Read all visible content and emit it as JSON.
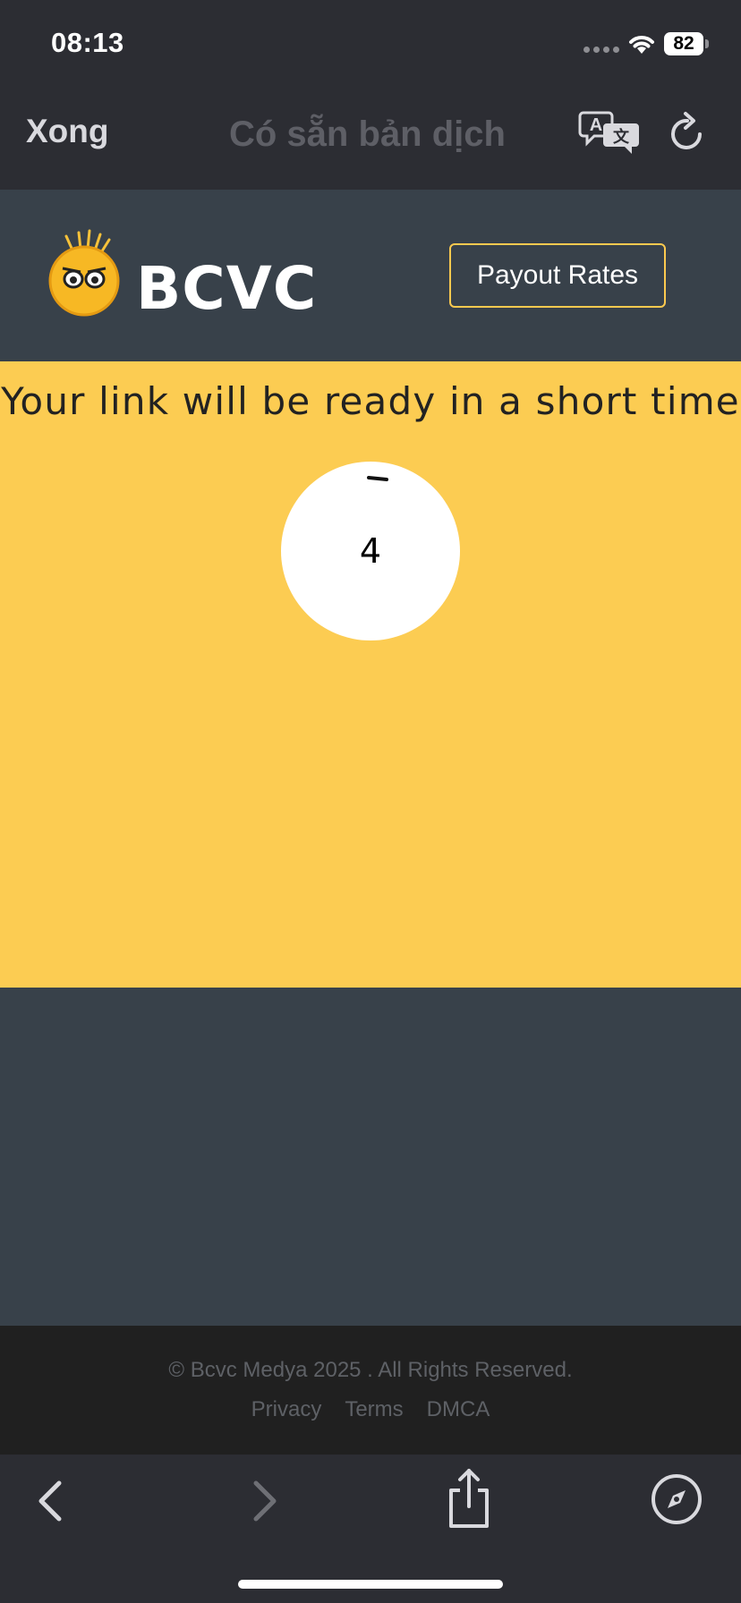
{
  "status_bar": {
    "time": "08:13",
    "battery": "82"
  },
  "browser_nav": {
    "done_label": "Xong",
    "title": "Có sẵn bản dịch",
    "translate_icon": "translate-icon",
    "reload_icon": "reload-icon"
  },
  "site_header": {
    "logo_text": "BCVC",
    "payout_label": "Payout Rates"
  },
  "main": {
    "headline": "Your link will be ready in a short time",
    "countdown": "4"
  },
  "footer": {
    "copyright": "© Bcvc Medya 2025 . All Rights Reserved.",
    "links": [
      "Privacy",
      "Terms",
      "DMCA"
    ]
  },
  "toolbar": {
    "back_icon": "chevron-left-icon",
    "forward_icon": "chevron-right-icon",
    "share_icon": "share-icon",
    "compass_icon": "compass-icon"
  },
  "colors": {
    "accent_yellow": "#fccc52",
    "header_bg": "#38414a",
    "footer_bg": "#202020",
    "chrome_bg": "#2c2d33"
  }
}
